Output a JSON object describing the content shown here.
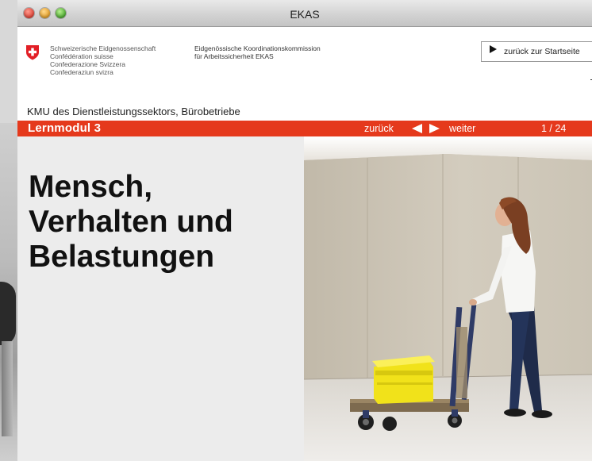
{
  "window": {
    "title": "EKAS"
  },
  "header": {
    "confederation_lines": [
      "Schweizerische Eidgenossenschaft",
      "Confédération suisse",
      "Confederazione Svizzera",
      "Confederaziun svizra"
    ],
    "commission_lines": [
      "Eidgenössische Koordinationskommission",
      "für Arbeitssicherheit EKAS"
    ],
    "back_to_start_label": "zurück zur Startseite"
  },
  "sector": "KMU des Dienstleistungssektors, Bürobetriebe",
  "navbar": {
    "module_label": "Lernmodul 3",
    "back_label": "zurück",
    "next_label": "weiter",
    "page_counter": "1 / 24"
  },
  "content": {
    "headline_lines": [
      "Mensch,",
      "Verhalten und",
      "Belastungen"
    ]
  },
  "colors": {
    "accent_red": "#e5391c",
    "panel_gray": "#ececec",
    "crate_yellow": "#f1e21a"
  },
  "icons": {
    "back_to_start": "play-triangle-right",
    "prev": "triangle-left",
    "next": "triangle-right"
  }
}
